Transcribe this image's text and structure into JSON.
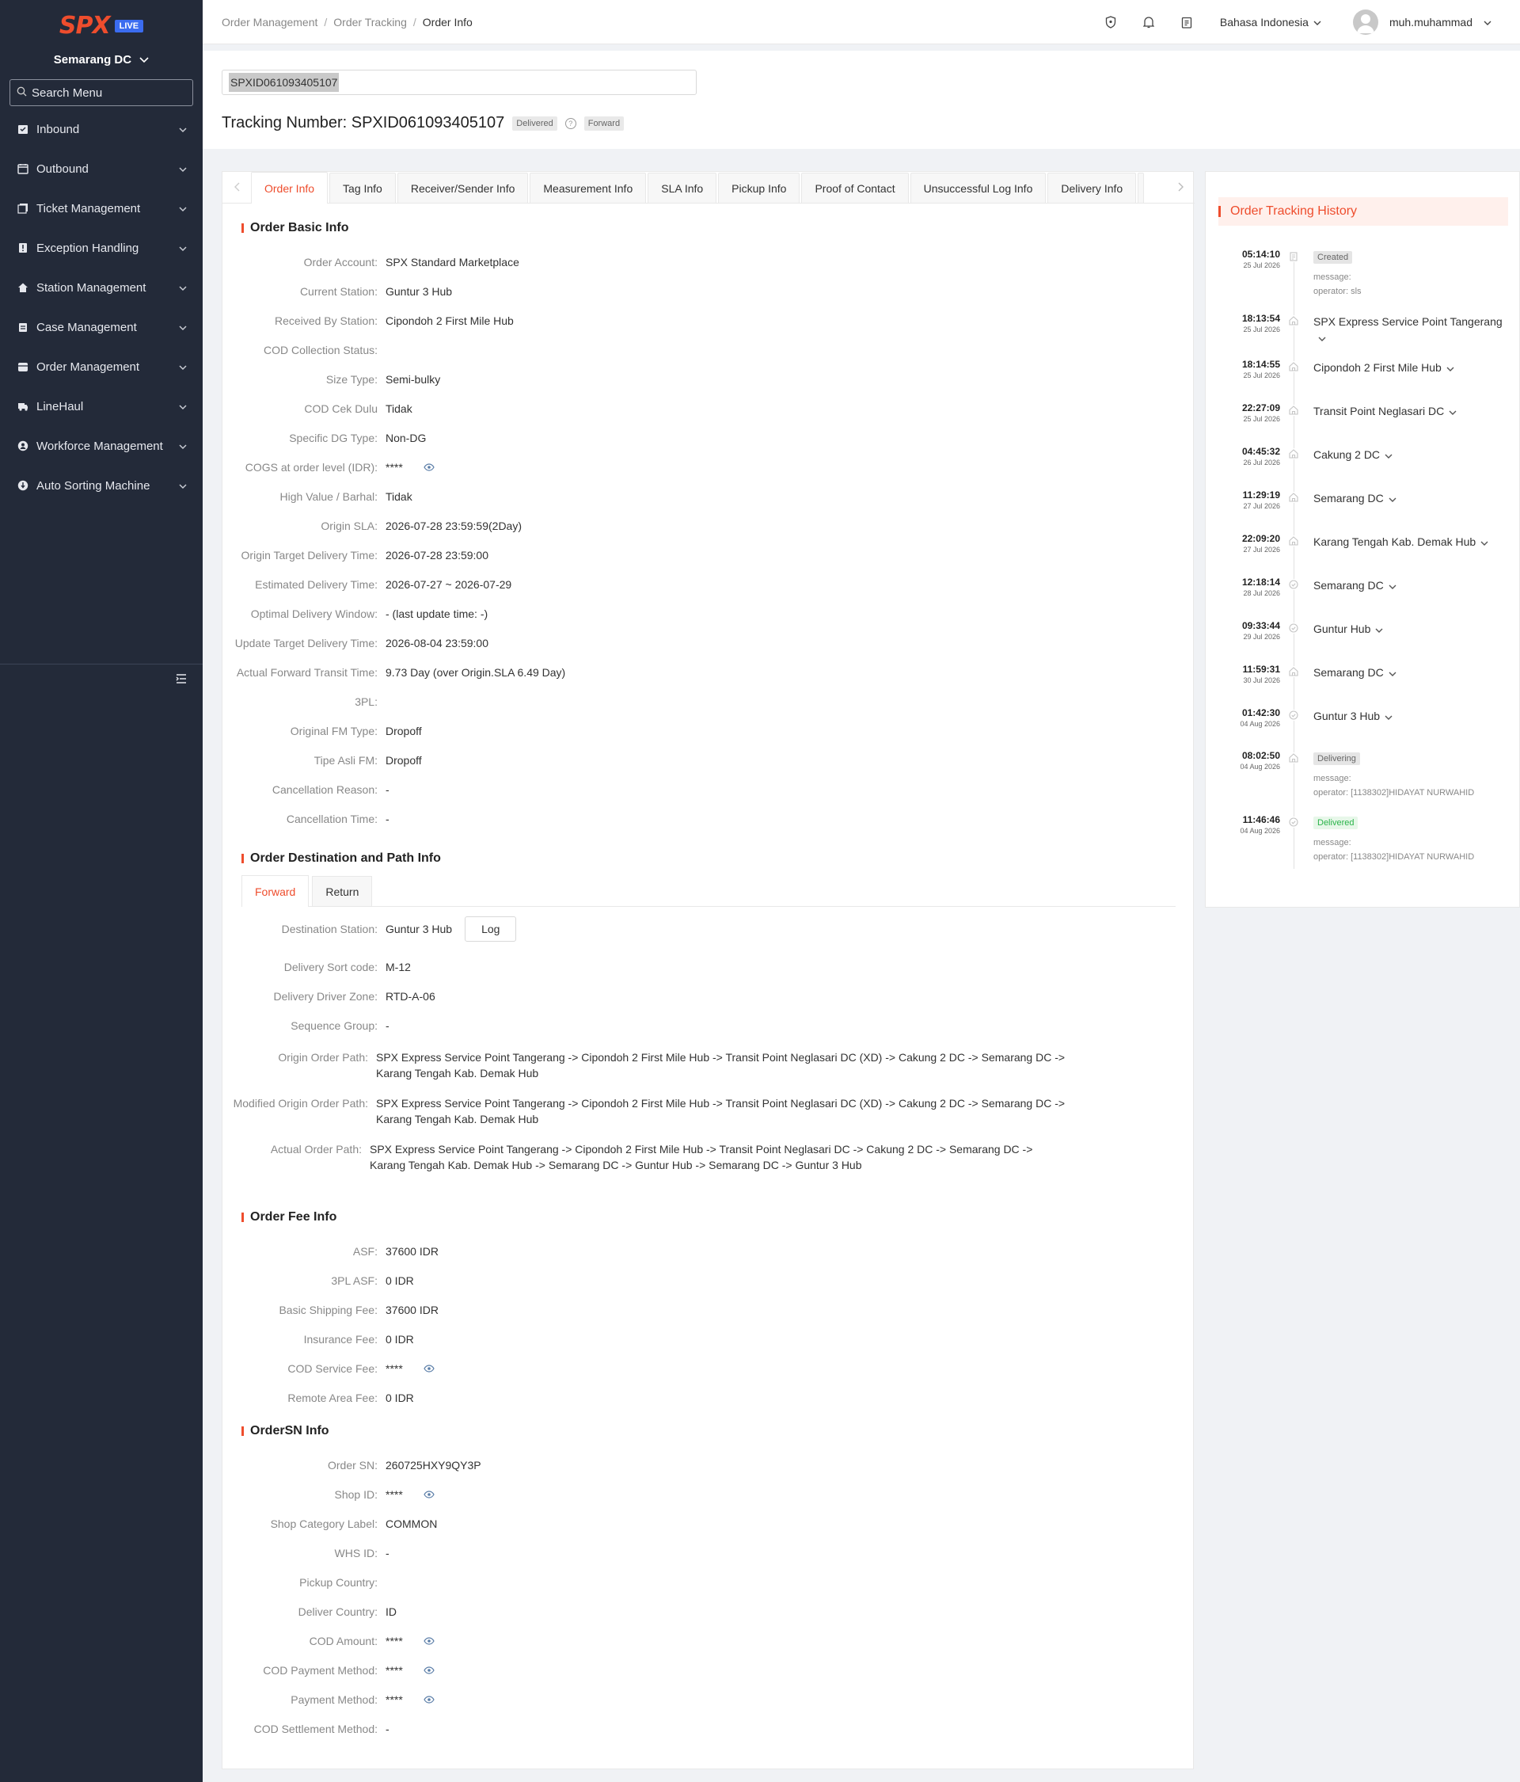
{
  "sidebar": {
    "logo": "SPX",
    "live_badge": "LIVE",
    "station": "Semarang DC",
    "search_placeholder": "Search Menu",
    "items": [
      {
        "label": "Inbound",
        "icon": "inbound-icon"
      },
      {
        "label": "Outbound",
        "icon": "outbound-icon"
      },
      {
        "label": "Ticket Management",
        "icon": "ticket-icon"
      },
      {
        "label": "Exception Handling",
        "icon": "exception-icon"
      },
      {
        "label": "Station Management",
        "icon": "home-icon"
      },
      {
        "label": "Case Management",
        "icon": "case-icon"
      },
      {
        "label": "Order Management",
        "icon": "order-icon"
      },
      {
        "label": "LineHaul",
        "icon": "truck-icon"
      },
      {
        "label": "Workforce Management",
        "icon": "user-icon"
      },
      {
        "label": "Auto Sorting Machine",
        "icon": "sorting-icon"
      }
    ]
  },
  "header": {
    "breadcrumb": [
      "Order Management",
      "Order Tracking",
      "Order Info"
    ],
    "language": "Bahasa Indonesia",
    "username": "muh.muhammad"
  },
  "order": {
    "search_value": "SPXID061093405107",
    "title_prefix": "Tracking Number: ",
    "tracking_number": "SPXID061093405107",
    "status_badge": "Delivered",
    "direction_badge": "Forward"
  },
  "tabs": [
    "Order Info",
    "Tag Info",
    "Receiver/Sender Info",
    "Measurement Info",
    "SLA Info",
    "Pickup Info",
    "Proof of Contact",
    "Unsuccessful Log Info",
    "Delivery Info"
  ],
  "basic_info": {
    "title": "Order Basic Info",
    "rows": [
      {
        "label": "Order Account:",
        "value": "SPX Standard Marketplace"
      },
      {
        "label": "Current Station:",
        "value": "Guntur 3 Hub"
      },
      {
        "label": "Received By Station:",
        "value": "Cipondoh 2 First Mile Hub"
      },
      {
        "label": "COD Collection Status:",
        "value": ""
      },
      {
        "label": "Size Type:",
        "value": "Semi-bulky"
      },
      {
        "label": "COD Cek Dulu",
        "value": "Tidak"
      },
      {
        "label": "Specific DG Type:",
        "value": "Non-DG"
      },
      {
        "label": "COGS at order level (IDR):",
        "value": "****"
      },
      {
        "label": "High Value / Barhal:",
        "value": "Tidak"
      },
      {
        "label": "Origin SLA:",
        "value": "2026-07-28 23:59:59(2Day)"
      },
      {
        "label": "Origin Target Delivery Time:",
        "value": "2026-07-28 23:59:00"
      },
      {
        "label": "Estimated Delivery Time:",
        "value": "2026-07-27 ~ 2026-07-29"
      },
      {
        "label": "Optimal Delivery Window:",
        "value": "- (last update time: -)"
      },
      {
        "label": "Update Target Delivery Time:",
        "value": "2026-08-04 23:59:00"
      },
      {
        "label": "Actual Forward Transit Time:",
        "value": "9.73 Day (over Origin.SLA 6.49 Day)"
      },
      {
        "label": "3PL:",
        "value": ""
      },
      {
        "label": "Original FM Type:",
        "value": "Dropoff"
      },
      {
        "label": "Tipe Asli FM:",
        "value": "Dropoff"
      },
      {
        "label": "Cancellation Reason:",
        "value": "-"
      },
      {
        "label": "Cancellation Time:",
        "value": "-"
      }
    ]
  },
  "destination": {
    "title": "Order Destination and Path Info",
    "sub_tabs": [
      "Forward",
      "Return"
    ],
    "log_button": "Log",
    "rows": [
      {
        "label": "Destination Station:",
        "value": "Guntur 3 Hub"
      },
      {
        "label": "Delivery Sort code:",
        "value": "M-12"
      },
      {
        "label": "Delivery Driver Zone:",
        "value": "RTD-A-06"
      },
      {
        "label": "Sequence Group:",
        "value": "-"
      }
    ],
    "paths": [
      {
        "label": "Origin Order Path:",
        "value": "SPX Express Service Point Tangerang  -> Cipondoh 2 First Mile Hub  -> Transit Point Neglasari DC (XD)  -> Cakung 2 DC  -> Semarang DC  -> Karang Tengah Kab. Demak Hub"
      },
      {
        "label": "Modified Origin Order Path:",
        "value": "SPX Express Service Point Tangerang  -> Cipondoh 2 First Mile Hub  -> Transit Point Neglasari DC (XD)  -> Cakung 2 DC  -> Semarang DC  -> Karang Tengah Kab. Demak Hub"
      },
      {
        "label": "Actual Order Path:",
        "value": "SPX Express Service Point Tangerang  -> Cipondoh 2 First Mile Hub  -> Transit Point Neglasari DC  -> Cakung 2 DC  -> Semarang DC  -> Karang Tengah Kab. Demak Hub  -> Semarang DC  -> Guntur Hub  -> Semarang DC  -> Guntur 3 Hub"
      }
    ]
  },
  "fee_info": {
    "title": "Order Fee Info",
    "rows": [
      {
        "label": "ASF:",
        "value": "37600 IDR"
      },
      {
        "label": "3PL ASF:",
        "value": "0 IDR"
      },
      {
        "label": "Basic Shipping Fee:",
        "value": "37600 IDR"
      },
      {
        "label": "Insurance Fee:",
        "value": "0 IDR"
      },
      {
        "label": "COD Service Fee:",
        "value": "****"
      },
      {
        "label": "Remote Area Fee:",
        "value": "0 IDR"
      }
    ]
  },
  "ordersn_info": {
    "title": "OrderSN Info",
    "rows": [
      {
        "label": "Order SN:",
        "value": "260725HXY9QY3P"
      },
      {
        "label": "Shop ID:",
        "value": "****"
      },
      {
        "label": "Shop Category Label:",
        "value": "COMMON"
      },
      {
        "label": "WHS ID:",
        "value": "-"
      },
      {
        "label": "Pickup Country:",
        "value": ""
      },
      {
        "label": "Deliver Country:",
        "value": "ID"
      },
      {
        "label": "COD Amount:",
        "value": "****"
      },
      {
        "label": "COD Payment Method:",
        "value": "****"
      },
      {
        "label": "Payment Method:",
        "value": "****"
      },
      {
        "label": "COD Settlement Method:",
        "value": "-"
      }
    ]
  },
  "history": {
    "title": "Order Tracking History",
    "events": [
      {
        "time": "05:14:10",
        "date": "25 Jul 2026",
        "badge": "Created",
        "message": "message:",
        "operator": "operator: sls"
      },
      {
        "time": "18:13:54",
        "date": "25 Jul 2026",
        "location": "SPX Express Service Point Tangerang"
      },
      {
        "time": "18:14:55",
        "date": "25 Jul 2026",
        "location": "Cipondoh 2 First Mile Hub"
      },
      {
        "time": "22:27:09",
        "date": "25 Jul 2026",
        "location": "Transit Point Neglasari DC"
      },
      {
        "time": "04:45:32",
        "date": "26 Jul 2026",
        "location": "Cakung 2 DC"
      },
      {
        "time": "11:29:19",
        "date": "27 Jul 2026",
        "location": "Semarang DC"
      },
      {
        "time": "22:09:20",
        "date": "27 Jul 2026",
        "location": "Karang Tengah Kab. Demak Hub"
      },
      {
        "time": "12:18:14",
        "date": "28 Jul 2026",
        "location": "Semarang DC"
      },
      {
        "time": "09:33:44",
        "date": "29 Jul 2026",
        "location": "Guntur Hub"
      },
      {
        "time": "11:59:31",
        "date": "30 Jul 2026",
        "location": "Semarang DC"
      },
      {
        "time": "01:42:30",
        "date": "04 Aug 2026",
        "location": "Guntur 3 Hub"
      },
      {
        "time": "08:02:50",
        "date": "04 Aug 2026",
        "badge": "Delivering",
        "message": "message:",
        "operator": "operator: [1138302]HIDAYAT NURWAHID"
      },
      {
        "time": "11:46:46",
        "date": "04 Aug 2026",
        "badge": "Delivered",
        "message": "message:",
        "operator": "operator: [1138302]HIDAYAT NURWAHID"
      }
    ]
  },
  "colors": {
    "accent": "#ee4d2d",
    "sidebar_bg": "#232a39",
    "delivered_green": "#2ab44a"
  }
}
